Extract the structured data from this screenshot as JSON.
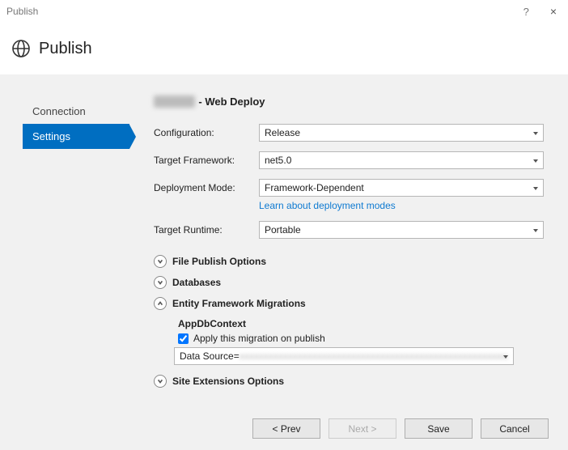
{
  "window": {
    "title": "Publish",
    "help": "?",
    "close": "×"
  },
  "header": {
    "title": "Publish"
  },
  "sidebar": {
    "items": [
      {
        "label": "Connection"
      },
      {
        "label": "Settings"
      }
    ],
    "activeIndex": 1
  },
  "content": {
    "profile_hidden": "xxxxxx",
    "profile_suffix": " - Web Deploy",
    "rows": {
      "configuration": {
        "label": "Configuration:",
        "value": "Release"
      },
      "targetFramework": {
        "label": "Target Framework:",
        "value": "net5.0"
      },
      "deploymentMode": {
        "label": "Deployment Mode:",
        "value": "Framework-Dependent"
      },
      "targetRuntime": {
        "label": "Target Runtime:",
        "value": "Portable"
      }
    },
    "deploymentModesLink": "Learn about deployment modes",
    "sections": {
      "filePublish": "File Publish Options",
      "databases": "Databases",
      "efMigrations": "Entity Framework Migrations",
      "siteExtensions": "Site Extensions Options"
    },
    "ef": {
      "context": "AppDbContext",
      "checkboxLabel": "Apply this migration on publish",
      "checked": true,
      "connectionPrefix": "Data Source=",
      "connectionHidden": "xxxxxxxxxxxxxxxxxxxxxxxxxxxxxxxxxxxxxxxxxxxxxxxxxxxxxxxxxxxxxxxxxxxxxxxxx"
    }
  },
  "buttons": {
    "prev": "< Prev",
    "next": "Next >",
    "save": "Save",
    "cancel": "Cancel"
  }
}
